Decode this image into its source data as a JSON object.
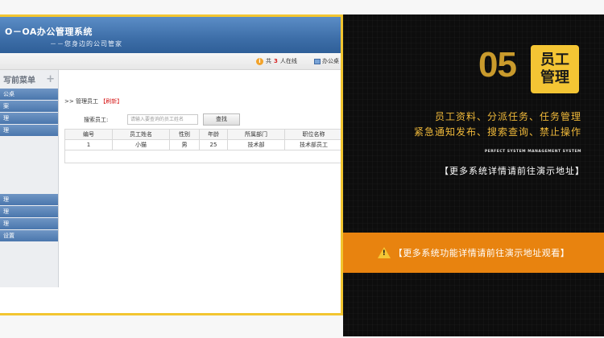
{
  "app": {
    "title": "O－OA办公管理系统",
    "subtitle": "－－您身边的公司管家"
  },
  "toolbar": {
    "online_prefix": "共",
    "online_count": "3",
    "online_suffix": "人在线",
    "desk_label": "办公桌"
  },
  "sidebar": {
    "title": "写前菜单",
    "items_top": [
      "公桌",
      "案",
      "理",
      "理"
    ],
    "items_bottom": [
      "理",
      "理",
      "理",
      "设置"
    ]
  },
  "main": {
    "breadcrumb_prefix": ">> 管理员工",
    "breadcrumb_refresh": "【刷新】",
    "search_label": "搜索员工:",
    "search_placeholder": "请输入要查询的员工姓名",
    "search_button": "查找",
    "columns": [
      "编号",
      "员工姓名",
      "性别",
      "年龄",
      "所属部门",
      "职位名称"
    ],
    "rows": [
      [
        "1",
        "小猫",
        "男",
        "25",
        "技术部",
        "技术部员工"
      ]
    ]
  },
  "promo": {
    "number": "05",
    "badge_line1": "员工",
    "badge_line2": "管理",
    "feature_line1": "员工资料、分派任务、任务管理",
    "feature_line2": "紧急通知发布、搜索查询、禁止操作",
    "english": "PERFECT SYSTEM MANAGEMENT SYSTEM",
    "demo_text": "【更多系统详情请前往演示地址】",
    "bar_text": "【更多系统功能详情请前往演示地址观看】"
  }
}
